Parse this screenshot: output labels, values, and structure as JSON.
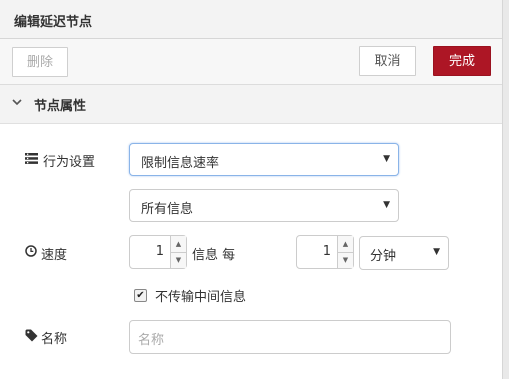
{
  "dialog": {
    "title": "编辑延迟节点"
  },
  "toolbar": {
    "delete_label": "删除",
    "cancel_label": "取消",
    "done_label": "完成"
  },
  "section": {
    "title": "节点属性",
    "collapse_icon": "chevron-down-icon"
  },
  "action": {
    "icon": "list-icon",
    "label": "行为设置",
    "mode_value": "限制信息速率",
    "scope_value": "所有信息"
  },
  "rate": {
    "icon": "clock-icon",
    "label": "速度",
    "count_value": "1",
    "text_messages_per": "信息 每",
    "period_value": "1",
    "unit_value": "分钟"
  },
  "drop": {
    "checked": true,
    "label": "不传输中间信息"
  },
  "name": {
    "icon": "tag-icon",
    "label": "名称",
    "placeholder": "名称"
  },
  "colors": {
    "done_button": "#ad1625",
    "header_bg": "#f3f3f3"
  }
}
